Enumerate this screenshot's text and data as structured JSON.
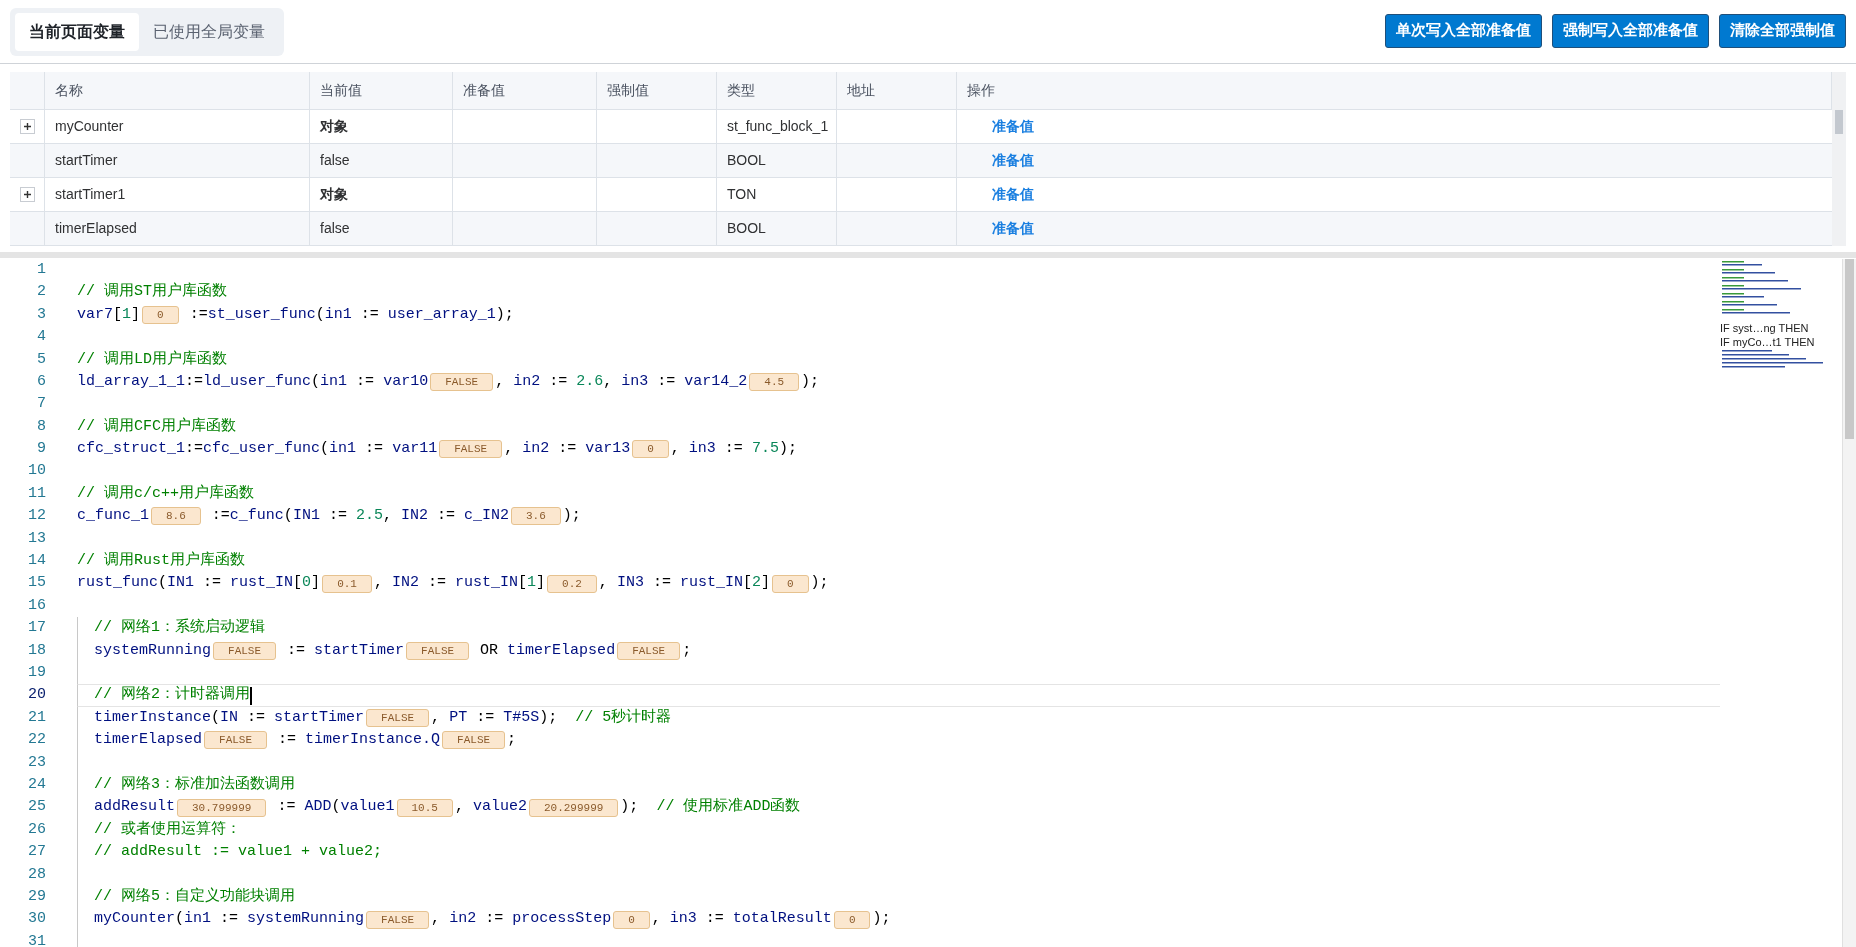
{
  "tabs": [
    {
      "label": "当前页面变量",
      "selected": true
    },
    {
      "label": "已使用全局变量",
      "selected": false
    }
  ],
  "actions": [
    "单次写入全部准备值",
    "强制写入全部准备值",
    "清除全部强制值"
  ],
  "table": {
    "columns": [
      "名称",
      "当前值",
      "准备值",
      "强制值",
      "类型",
      "地址",
      "操作"
    ],
    "rows": [
      {
        "expandable": true,
        "name": "myCounter",
        "current": "对象",
        "current_is_object": true,
        "type": "st_func_block_1",
        "action": "准备值"
      },
      {
        "expandable": false,
        "name": "startTimer",
        "current": "false",
        "current_is_object": false,
        "type": "BOOL",
        "action": "准备值"
      },
      {
        "expandable": true,
        "name": "startTimer1",
        "current": "对象",
        "current_is_object": true,
        "type": "TON",
        "action": "准备值"
      },
      {
        "expandable": false,
        "name": "timerElapsed",
        "current": "false",
        "current_is_object": false,
        "type": "BOOL",
        "action": "准备值"
      }
    ]
  },
  "editor": {
    "segments": [
      {
        "kind": "top",
        "lines": [
          {
            "number": "1",
            "current": false
          },
          {
            "number": "2",
            "current": false,
            "tokens": [
              {
                "kind": "comment",
                "text": "// 调用ST用户库函数"
              }
            ]
          },
          {
            "number": "3",
            "current": false,
            "tokens": [
              {
                "kind": "ident",
                "text": "var7"
              },
              {
                "kind": "punct",
                "text": "["
              },
              {
                "kind": "num",
                "text": "1"
              },
              {
                "kind": "punct",
                "text": "]"
              },
              {
                "kind": "value",
                "text": "0"
              },
              {
                "kind": "punct",
                "text": " :="
              },
              {
                "kind": "ident",
                "text": "st_user_func"
              },
              {
                "kind": "punct",
                "text": "("
              },
              {
                "kind": "ident",
                "text": "in1"
              },
              {
                "kind": "punct",
                "text": " := "
              },
              {
                "kind": "ident",
                "text": "user_array_1"
              },
              {
                "kind": "punct",
                "text": ");"
              }
            ]
          },
          {
            "number": "4",
            "current": false
          },
          {
            "number": "5",
            "current": false,
            "tokens": [
              {
                "kind": "comment",
                "text": "// 调用LD用户库函数"
              }
            ]
          },
          {
            "number": "6",
            "current": false,
            "tokens": [
              {
                "kind": "ident",
                "text": "ld_array_1_1"
              },
              {
                "kind": "punct",
                "text": ":="
              },
              {
                "kind": "ident",
                "text": "ld_user_func"
              },
              {
                "kind": "punct",
                "text": "("
              },
              {
                "kind": "ident",
                "text": "in1"
              },
              {
                "kind": "punct",
                "text": " := "
              },
              {
                "kind": "ident",
                "text": "var10"
              },
              {
                "kind": "value",
                "text": "FALSE"
              },
              {
                "kind": "punct",
                "text": ", "
              },
              {
                "kind": "ident",
                "text": "in2"
              },
              {
                "kind": "punct",
                "text": " := "
              },
              {
                "kind": "num",
                "text": "2.6"
              },
              {
                "kind": "punct",
                "text": ", "
              },
              {
                "kind": "ident",
                "text": "in3"
              },
              {
                "kind": "punct",
                "text": " := "
              },
              {
                "kind": "ident",
                "text": "var14_2"
              },
              {
                "kind": "value",
                "text": "4.5"
              },
              {
                "kind": "punct",
                "text": ");"
              }
            ]
          },
          {
            "number": "7",
            "current": false
          },
          {
            "number": "8",
            "current": false,
            "tokens": [
              {
                "kind": "comment",
                "text": "// 调用CFC用户库函数"
              }
            ]
          },
          {
            "number": "9",
            "current": false,
            "tokens": [
              {
                "kind": "ident",
                "text": "cfc_struct_1"
              },
              {
                "kind": "punct",
                "text": ":="
              },
              {
                "kind": "ident",
                "text": "cfc_user_func"
              },
              {
                "kind": "punct",
                "text": "("
              },
              {
                "kind": "ident",
                "text": "in1"
              },
              {
                "kind": "punct",
                "text": " := "
              },
              {
                "kind": "ident",
                "text": "var11"
              },
              {
                "kind": "value",
                "text": "FALSE"
              },
              {
                "kind": "punct",
                "text": ", "
              },
              {
                "kind": "ident",
                "text": "in2"
              },
              {
                "kind": "punct",
                "text": " := "
              },
              {
                "kind": "ident",
                "text": "var13"
              },
              {
                "kind": "value",
                "text": "0"
              },
              {
                "kind": "punct",
                "text": ", "
              },
              {
                "kind": "ident",
                "text": "in3"
              },
              {
                "kind": "punct",
                "text": " := "
              },
              {
                "kind": "num",
                "text": "7.5"
              },
              {
                "kind": "punct",
                "text": ");"
              }
            ]
          },
          {
            "number": "10",
            "current": false
          },
          {
            "number": "11",
            "current": false,
            "tokens": [
              {
                "kind": "comment",
                "text": "// 调用c/c++用户库函数"
              }
            ]
          },
          {
            "number": "12",
            "current": false,
            "tokens": [
              {
                "kind": "ident",
                "text": "c_func_1"
              },
              {
                "kind": "value",
                "text": "8.6"
              },
              {
                "kind": "punct",
                "text": " :="
              },
              {
                "kind": "ident",
                "text": "c_func"
              },
              {
                "kind": "punct",
                "text": "("
              },
              {
                "kind": "ident",
                "text": "IN1"
              },
              {
                "kind": "punct",
                "text": " := "
              },
              {
                "kind": "num",
                "text": "2.5"
              },
              {
                "kind": "punct",
                "text": ", "
              },
              {
                "kind": "ident",
                "text": "IN2"
              },
              {
                "kind": "punct",
                "text": " := "
              },
              {
                "kind": "ident",
                "text": "c_IN2"
              },
              {
                "kind": "value",
                "text": "3.6"
              },
              {
                "kind": "punct",
                "text": ");"
              }
            ]
          },
          {
            "number": "13",
            "current": false
          },
          {
            "number": "14",
            "current": false,
            "tokens": [
              {
                "kind": "comment",
                "text": "// 调用Rust用户库函数"
              }
            ]
          },
          {
            "number": "15",
            "current": false,
            "tokens": [
              {
                "kind": "ident",
                "text": "rust_func"
              },
              {
                "kind": "punct",
                "text": "("
              },
              {
                "kind": "ident",
                "text": "IN1"
              },
              {
                "kind": "punct",
                "text": " := "
              },
              {
                "kind": "ident",
                "text": "rust_IN"
              },
              {
                "kind": "punct",
                "text": "["
              },
              {
                "kind": "num",
                "text": "0"
              },
              {
                "kind": "punct",
                "text": "]"
              },
              {
                "kind": "value",
                "text": "0.1"
              },
              {
                "kind": "punct",
                "text": ", "
              },
              {
                "kind": "ident",
                "text": "IN2"
              },
              {
                "kind": "punct",
                "text": " := "
              },
              {
                "kind": "ident",
                "text": "rust_IN"
              },
              {
                "kind": "punct",
                "text": "["
              },
              {
                "kind": "num",
                "text": "1"
              },
              {
                "kind": "punct",
                "text": "]"
              },
              {
                "kind": "value",
                "text": "0.2"
              },
              {
                "kind": "punct",
                "text": ", "
              },
              {
                "kind": "ident",
                "text": "IN3"
              },
              {
                "kind": "punct",
                "text": " := "
              },
              {
                "kind": "ident",
                "text": "rust_IN"
              },
              {
                "kind": "punct",
                "text": "["
              },
              {
                "kind": "num",
                "text": "2"
              },
              {
                "kind": "punct",
                "text": "]"
              },
              {
                "kind": "value",
                "text": "0"
              },
              {
                "kind": "punct",
                "text": ");"
              }
            ]
          },
          {
            "number": "16",
            "current": false
          }
        ]
      },
      {
        "kind": "block",
        "lines": [
          {
            "number": "17",
            "current": false,
            "tokens": [
              {
                "kind": "comment",
                "text": "// 网络1：系统启动逻辑"
              }
            ]
          },
          {
            "number": "18",
            "current": false,
            "tokens": [
              {
                "kind": "ident",
                "text": "systemRunning"
              },
              {
                "kind": "value",
                "text": "FALSE"
              },
              {
                "kind": "punct",
                "text": " := "
              },
              {
                "kind": "ident",
                "text": "startTimer"
              },
              {
                "kind": "value",
                "text": "FALSE"
              },
              {
                "kind": "punct",
                "text": " OR "
              },
              {
                "kind": "ident",
                "text": "timerElapsed"
              },
              {
                "kind": "value",
                "text": "FALSE"
              },
              {
                "kind": "punct",
                "text": ";"
              }
            ]
          },
          {
            "number": "19",
            "current": false
          },
          {
            "number": "20",
            "current": true,
            "tokens": [
              {
                "kind": "comment",
                "text": "// 网络2：计时器调用"
              }
            ]
          },
          {
            "number": "21",
            "current": false,
            "tokens": [
              {
                "kind": "ident",
                "text": "timerInstance"
              },
              {
                "kind": "punct",
                "text": "("
              },
              {
                "kind": "ident",
                "text": "IN"
              },
              {
                "kind": "punct",
                "text": " := "
              },
              {
                "kind": "ident",
                "text": "startTimer"
              },
              {
                "kind": "value",
                "text": "FALSE"
              },
              {
                "kind": "punct",
                "text": ", "
              },
              {
                "kind": "ident",
                "text": "PT"
              },
              {
                "kind": "punct",
                "text": " := "
              },
              {
                "kind": "ident",
                "text": "T#5S"
              },
              {
                "kind": "punct",
                "text": ");  "
              },
              {
                "kind": "comment",
                "text": "// 5秒计时器"
              }
            ]
          },
          {
            "number": "22",
            "current": false,
            "tokens": [
              {
                "kind": "ident",
                "text": "timerElapsed"
              },
              {
                "kind": "value",
                "text": "FALSE"
              },
              {
                "kind": "punct",
                "text": " := "
              },
              {
                "kind": "ident",
                "text": "timerInstance.Q"
              },
              {
                "kind": "value",
                "text": "FALSE"
              },
              {
                "kind": "punct",
                "text": ";"
              }
            ]
          },
          {
            "number": "23",
            "current": false
          },
          {
            "number": "24",
            "current": false,
            "tokens": [
              {
                "kind": "comment",
                "text": "// 网络3：标准加法函数调用"
              }
            ]
          },
          {
            "number": "25",
            "current": false,
            "tokens": [
              {
                "kind": "ident",
                "text": "addResult"
              },
              {
                "kind": "value",
                "text": "30.799999"
              },
              {
                "kind": "punct",
                "text": " := "
              },
              {
                "kind": "ident",
                "text": "ADD"
              },
              {
                "kind": "punct",
                "text": "("
              },
              {
                "kind": "ident",
                "text": "value1"
              },
              {
                "kind": "value",
                "text": "10.5"
              },
              {
                "kind": "punct",
                "text": ", "
              },
              {
                "kind": "ident",
                "text": "value2"
              },
              {
                "kind": "value",
                "text": "20.299999"
              },
              {
                "kind": "punct",
                "text": ");  "
              },
              {
                "kind": "comment",
                "text": "// 使用标准ADD函数"
              }
            ]
          },
          {
            "number": "26",
            "current": false,
            "tokens": [
              {
                "kind": "comment",
                "text": "// 或者使用运算符："
              }
            ]
          },
          {
            "number": "27",
            "current": false,
            "tokens": [
              {
                "kind": "comment",
                "text": "// addResult := value1 + value2;"
              }
            ]
          },
          {
            "number": "28",
            "current": false
          },
          {
            "number": "29",
            "current": false,
            "tokens": [
              {
                "kind": "comment",
                "text": "// 网络5：自定义功能块调用"
              }
            ]
          },
          {
            "number": "30",
            "current": false,
            "tokens": [
              {
                "kind": "ident",
                "text": "myCounter"
              },
              {
                "kind": "punct",
                "text": "("
              },
              {
                "kind": "ident",
                "text": "in1"
              },
              {
                "kind": "punct",
                "text": " := "
              },
              {
                "kind": "ident",
                "text": "systemRunning"
              },
              {
                "kind": "value",
                "text": "FALSE"
              },
              {
                "kind": "punct",
                "text": ", "
              },
              {
                "kind": "ident",
                "text": "in2"
              },
              {
                "kind": "punct",
                "text": " := "
              },
              {
                "kind": "ident",
                "text": "processStep"
              },
              {
                "kind": "value",
                "text": "0"
              },
              {
                "kind": "punct",
                "text": ", "
              },
              {
                "kind": "ident",
                "text": "in3"
              },
              {
                "kind": "punct",
                "text": " := "
              },
              {
                "kind": "ident",
                "text": "totalResult"
              },
              {
                "kind": "value",
                "text": "0"
              },
              {
                "kind": "punct",
                "text": ");"
              }
            ]
          },
          {
            "number": "31",
            "current": false
          }
        ]
      }
    ]
  },
  "minimap": {
    "labels": [
      "IF syst…ng THEN",
      "IF myCo…t1 THEN"
    ]
  }
}
